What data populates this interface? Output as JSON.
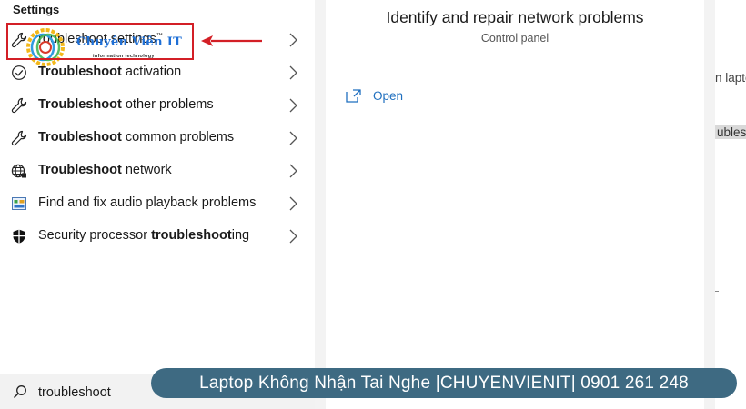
{
  "search_panel": {
    "section_label": "Settings",
    "results": [
      {
        "icon": "wrench-icon",
        "bold": "",
        "rest": "roubleshoot settings"
      },
      {
        "icon": "circle-check-icon",
        "bold": "Troubleshoot",
        "rest": " activation"
      },
      {
        "icon": "wrench-icon",
        "bold": "Troubleshoot",
        "rest": " other problems"
      },
      {
        "icon": "wrench-icon",
        "bold": "Troubleshoot",
        "rest": " common problems"
      },
      {
        "icon": "globe-icon",
        "bold": "Troubleshoot",
        "rest": " network"
      },
      {
        "icon": "control-panel-icon",
        "bold": "",
        "rest": "Find and fix audio playback problems"
      },
      {
        "icon": "shield-icon",
        "prefix": "Security processor ",
        "bold": "troubleshoot",
        "rest": "ing"
      }
    ],
    "search_query": "troubleshoot",
    "superscript_mark": "™"
  },
  "preview": {
    "title": "Identify and repair network problems",
    "subtitle": "Control panel",
    "open_label": "Open"
  },
  "background_window": {
    "text_1": "n lapto",
    "text_2": "ublesh"
  },
  "watermark": {
    "logo_text": "Chuyên Viên IT",
    "logo_subtext": "information technology"
  },
  "banner": {
    "text": "Laptop Không Nhận Tai Nghe |CHUYENVIENIT| 0901 261 248"
  },
  "colors": {
    "accent_link": "#1f6fbf",
    "highlight_border": "#d31f26",
    "banner_bg": "#3e6a82"
  }
}
